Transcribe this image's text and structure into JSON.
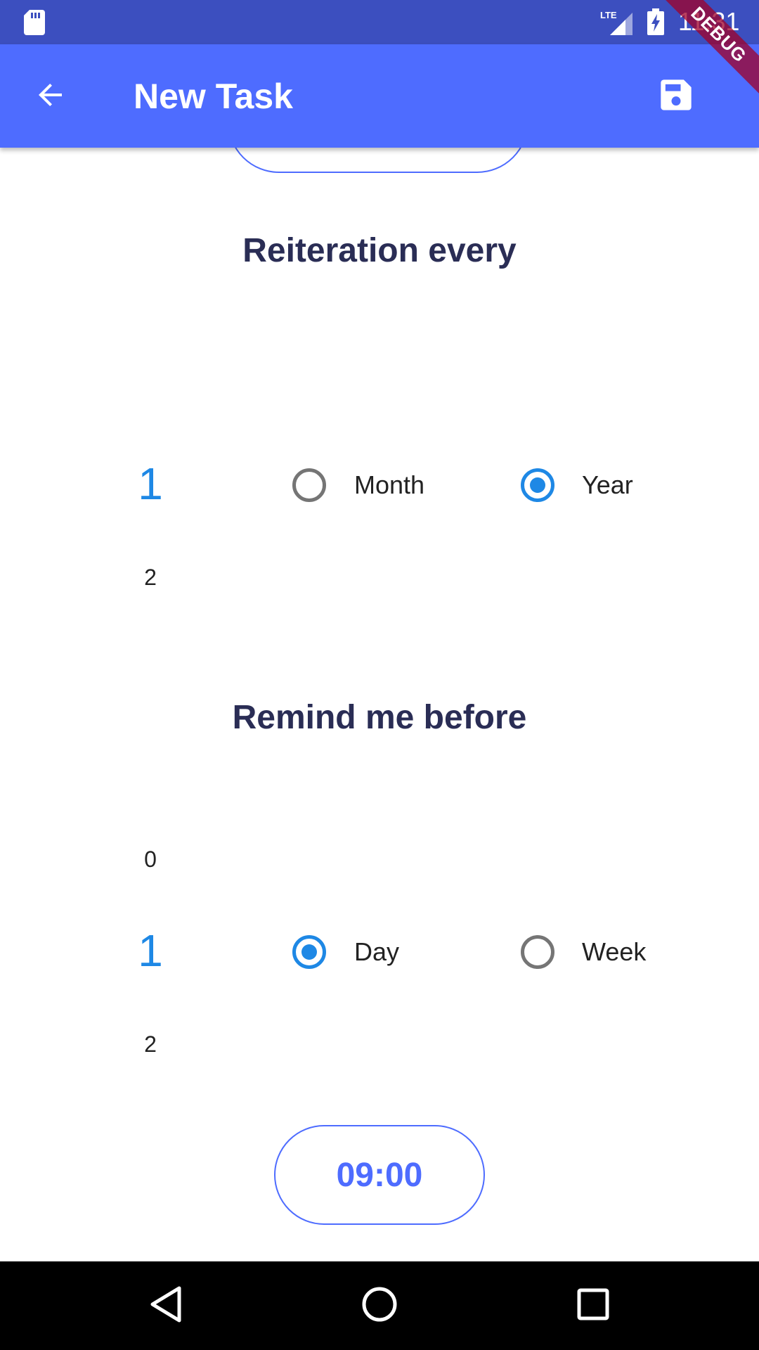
{
  "status_bar": {
    "time": "11:31",
    "icons": [
      "sd-card-icon",
      "lte-signal-icon",
      "battery-charging-icon"
    ]
  },
  "app_bar": {
    "title": "New Task",
    "back_icon": "arrow-back-icon",
    "save_icon": "save-icon"
  },
  "debug_banner": "DEBUG",
  "reiteration": {
    "title": "Reiteration every",
    "picker_values": [
      "1",
      "2"
    ],
    "options": [
      {
        "label": "Month",
        "selected": false
      },
      {
        "label": "Year",
        "selected": true
      }
    ]
  },
  "remind": {
    "title": "Remind me before",
    "picker_values": [
      "0",
      "1",
      "2"
    ],
    "options": [
      {
        "label": "Day",
        "selected": true
      },
      {
        "label": "Week",
        "selected": false
      }
    ]
  },
  "time_button": {
    "label": "09:00"
  },
  "nav_bar": {
    "icons": [
      "nav-back-icon",
      "nav-home-icon",
      "nav-recents-icon"
    ]
  },
  "colors": {
    "status_bar": "#3c4fbf",
    "app_bar": "#4e6cff",
    "accent": "#1e88e5",
    "title_text": "#2a2d55"
  }
}
